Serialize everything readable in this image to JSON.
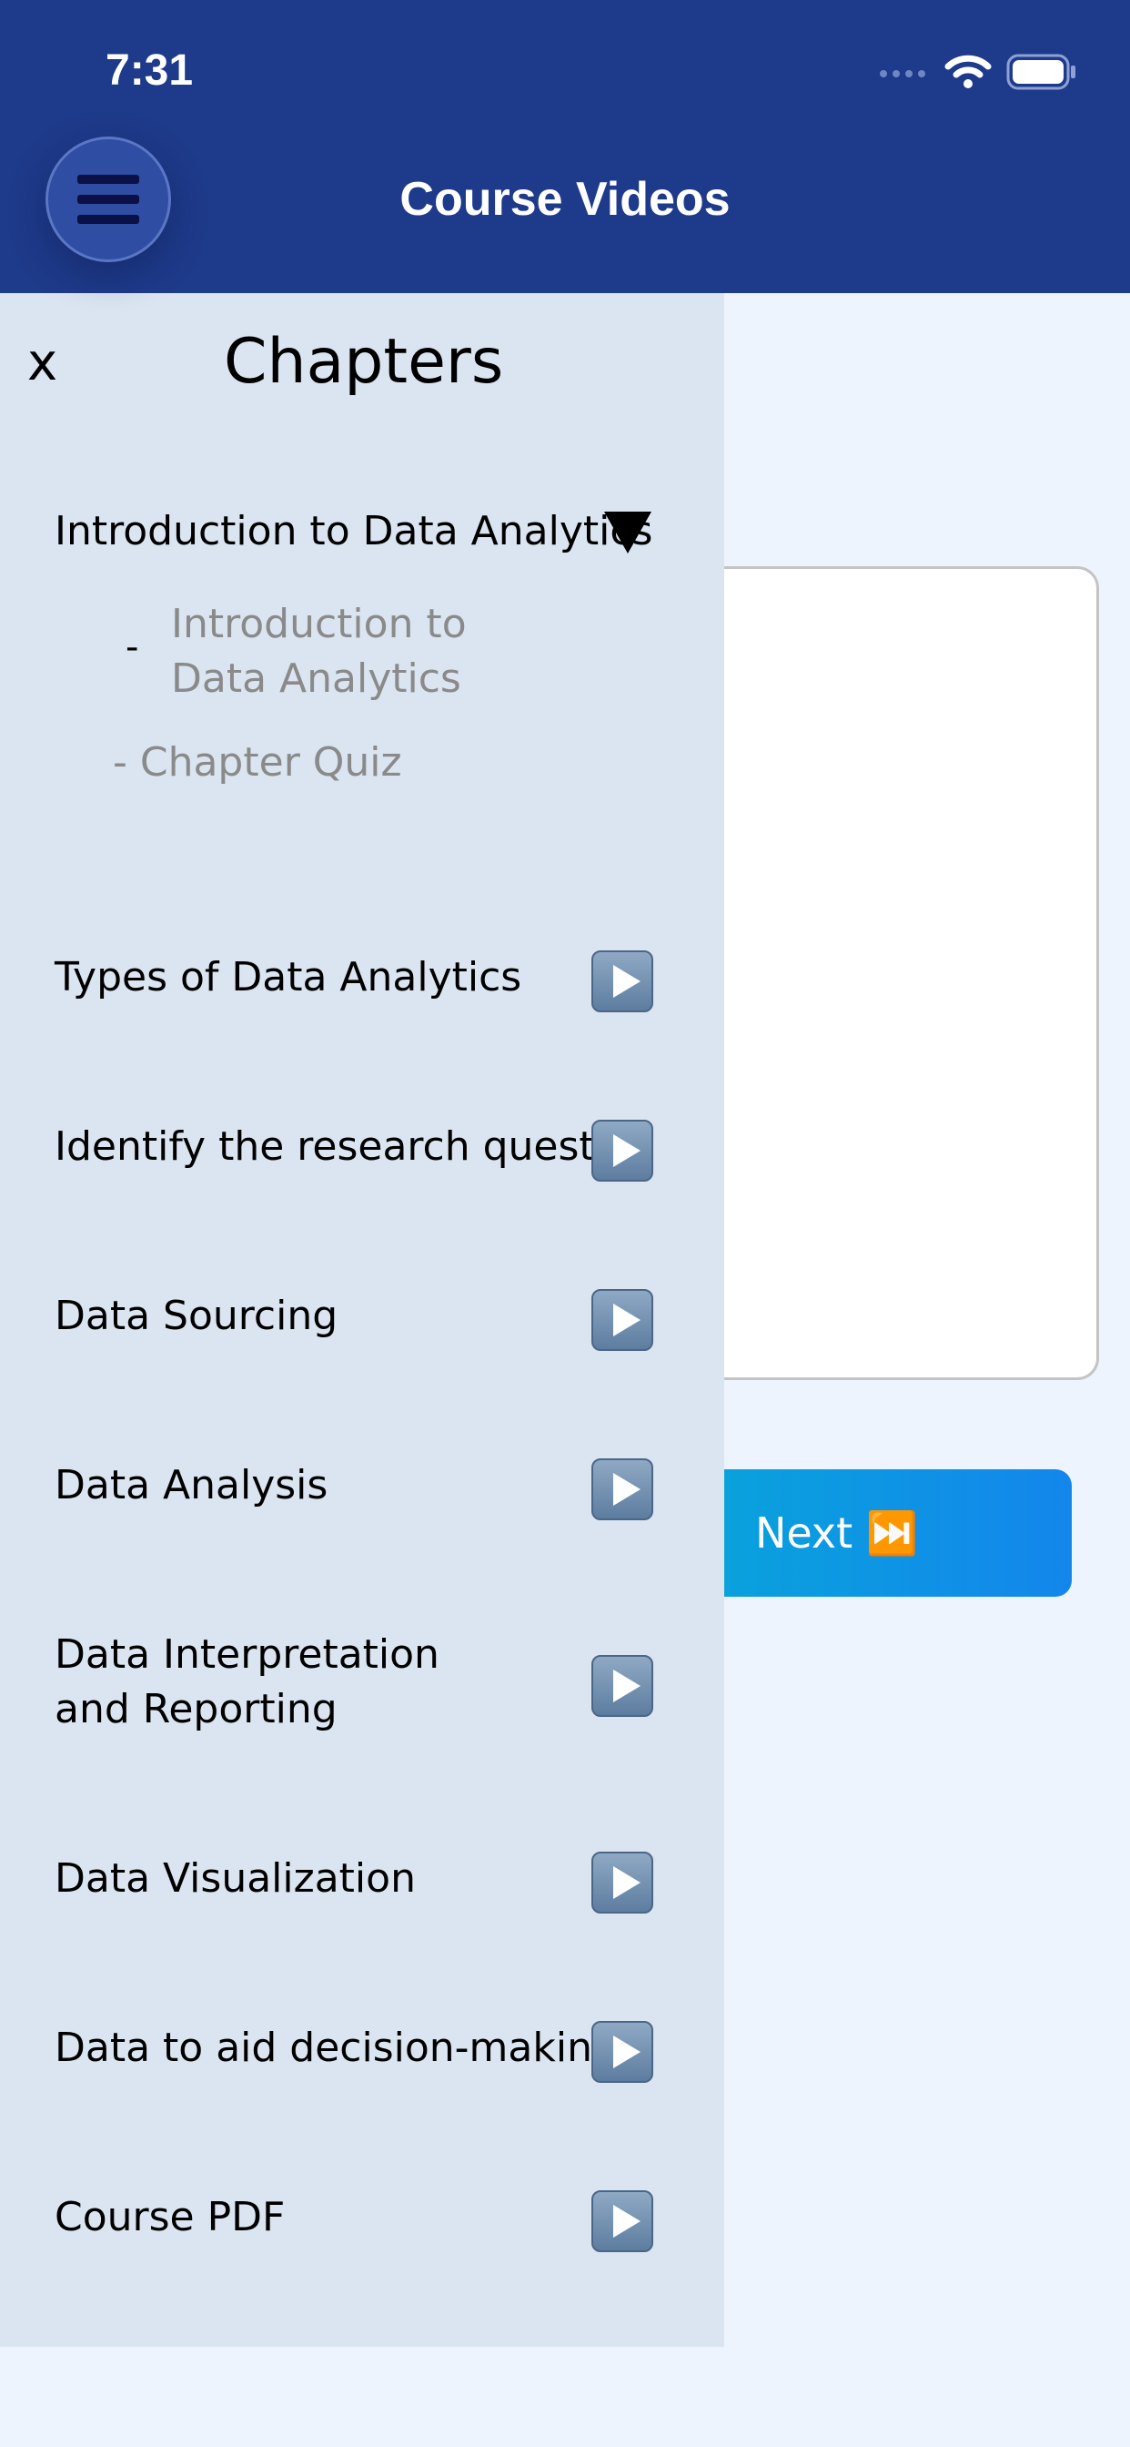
{
  "status_bar": {
    "time": "7:31"
  },
  "header": {
    "title": "Course Videos"
  },
  "drawer": {
    "close_label": "x",
    "title": "Chapters",
    "expanded_chapter": {
      "label": "Introduction to Data Analytics",
      "subitems": [
        {
          "dash": "-",
          "line1": "Introduction to",
          "line2": "Data Analytics"
        },
        {
          "label": "- Chapter Quiz"
        }
      ]
    },
    "chapters": [
      {
        "label": "Types of Data Analytics"
      },
      {
        "label": "Identify the research question"
      },
      {
        "label": "Data Sourcing"
      },
      {
        "label": "Data Analysis"
      },
      {
        "line1": "Data Interpretation",
        "line2": "and Reporting"
      },
      {
        "label": "Data Visualization"
      },
      {
        "label": "Data to aid decision-making"
      },
      {
        "label": "Course PDF"
      }
    ]
  },
  "main": {
    "next_label": "Next ⏭️"
  },
  "colors": {
    "header_bg": "#1e3a8a",
    "drawer_bg": "#dae5f1",
    "page_bg": "#eef4fd",
    "next_gradient_start": "#07a8d9",
    "next_gradient_end": "#1386ec"
  },
  "icons": {
    "menu": "hamburger-menu-icon",
    "play": "play-button-icon",
    "expand": "triangle-down-icon"
  }
}
